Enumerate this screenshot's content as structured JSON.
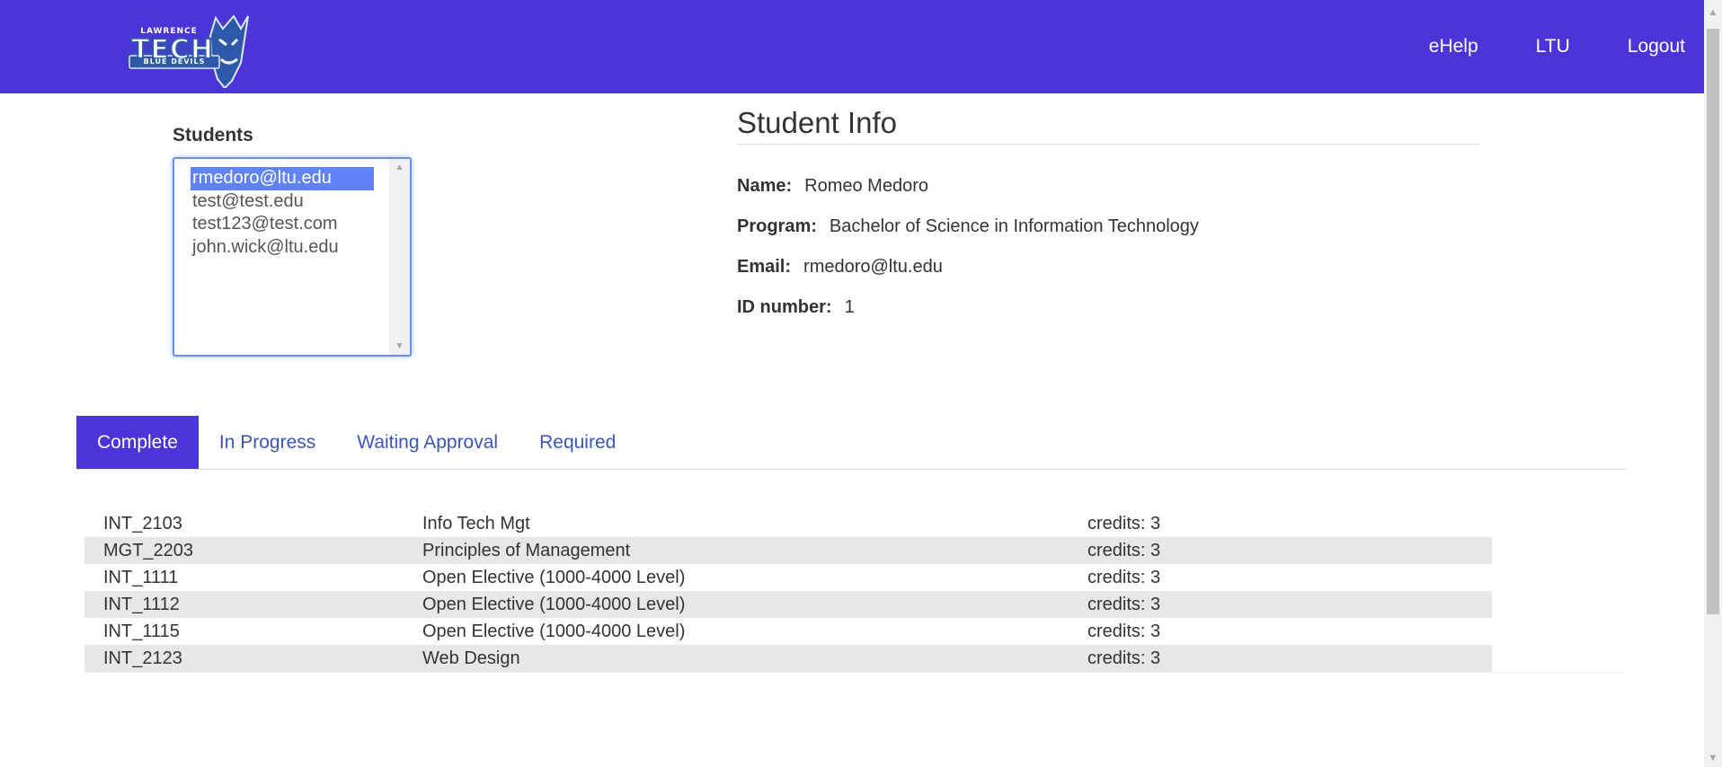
{
  "header": {
    "logo_text": "LAWRENCE TECH BLUE DEVILS",
    "nav": [
      "eHelp",
      "LTU",
      "Logout"
    ]
  },
  "students": {
    "label": "Students",
    "options": [
      "rmedoro@ltu.edu",
      "test@test.edu",
      "test123@test.com",
      "john.wick@ltu.edu"
    ],
    "selected": "rmedoro@ltu.edu"
  },
  "student_info": {
    "title": "Student Info",
    "name_label": "Name:",
    "name": "Romeo Medoro",
    "program_label": "Program:",
    "program": "Bachelor of Science in Information Technology",
    "email_label": "Email:",
    "email": "rmedoro@ltu.edu",
    "id_label": "ID number:",
    "id": "1"
  },
  "tabs": [
    "Complete",
    "In Progress",
    "Waiting Approval",
    "Required"
  ],
  "active_tab": "Complete",
  "courses": [
    {
      "code": "INT_2103",
      "name": "Info Tech Mgt",
      "credits": "credits: 3"
    },
    {
      "code": "MGT_2203",
      "name": "Principles of Management",
      "credits": "credits: 3"
    },
    {
      "code": "INT_1111",
      "name": "Open Elective (1000-4000 Level)",
      "credits": "credits: 3"
    },
    {
      "code": "INT_1112",
      "name": "Open Elective (1000-4000 Level)",
      "credits": "credits: 3"
    },
    {
      "code": "INT_1115",
      "name": "Open Elective (1000-4000 Level)",
      "credits": "credits: 3"
    },
    {
      "code": "INT_2123",
      "name": "Web Design",
      "credits": "credits: 3"
    }
  ],
  "colors": {
    "brand": "#4a36d8",
    "selection": "#5f83f4",
    "tab_link": "#3c55b8",
    "row_alt": "#e7e7e7"
  }
}
